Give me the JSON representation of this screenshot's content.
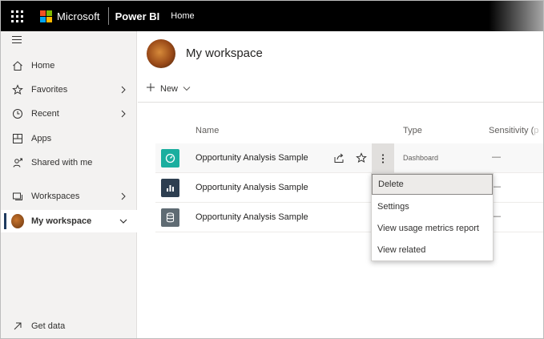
{
  "topbar": {
    "brand": "Microsoft",
    "app": "Power BI",
    "breadcrumb": "Home",
    "logo_colors": [
      "#f25022",
      "#7fba00",
      "#00a4ef",
      "#ffb900"
    ]
  },
  "sidebar": {
    "items": [
      {
        "label": "Home",
        "icon": "home-icon"
      },
      {
        "label": "Favorites",
        "icon": "star-icon"
      },
      {
        "label": "Recent",
        "icon": "clock-icon"
      },
      {
        "label": "Apps",
        "icon": "apps-icon"
      },
      {
        "label": "Shared with me",
        "icon": "shared-icon"
      },
      {
        "label": "Workspaces",
        "icon": "workspaces-icon"
      },
      {
        "label": "My workspace",
        "icon": "avatar"
      }
    ],
    "get_data": "Get data"
  },
  "main": {
    "title": "My workspace",
    "new_label": "New",
    "columns": {
      "name": "Name",
      "type": "Type",
      "sensitivity_visible": "Sensitivity (",
      "sensitivity_faded": "p"
    },
    "rows": [
      {
        "name": "Opportunity Analysis Sample",
        "type": "Dashboard",
        "sensitivity": "—",
        "icon": "dashboard-icon",
        "icon_color": "#1aae9f"
      },
      {
        "name": "Opportunity Analysis Sample",
        "type": "",
        "sensitivity": "—",
        "icon": "report-icon",
        "icon_color": "#2d3e50"
      },
      {
        "name": "Opportunity Analysis Sample",
        "type": "",
        "sensitivity": "—",
        "icon": "dataset-icon",
        "icon_color": "#5f6b73"
      }
    ]
  },
  "context_menu": {
    "items": [
      "Delete",
      "Settings",
      "View usage metrics report",
      "View related"
    ]
  }
}
